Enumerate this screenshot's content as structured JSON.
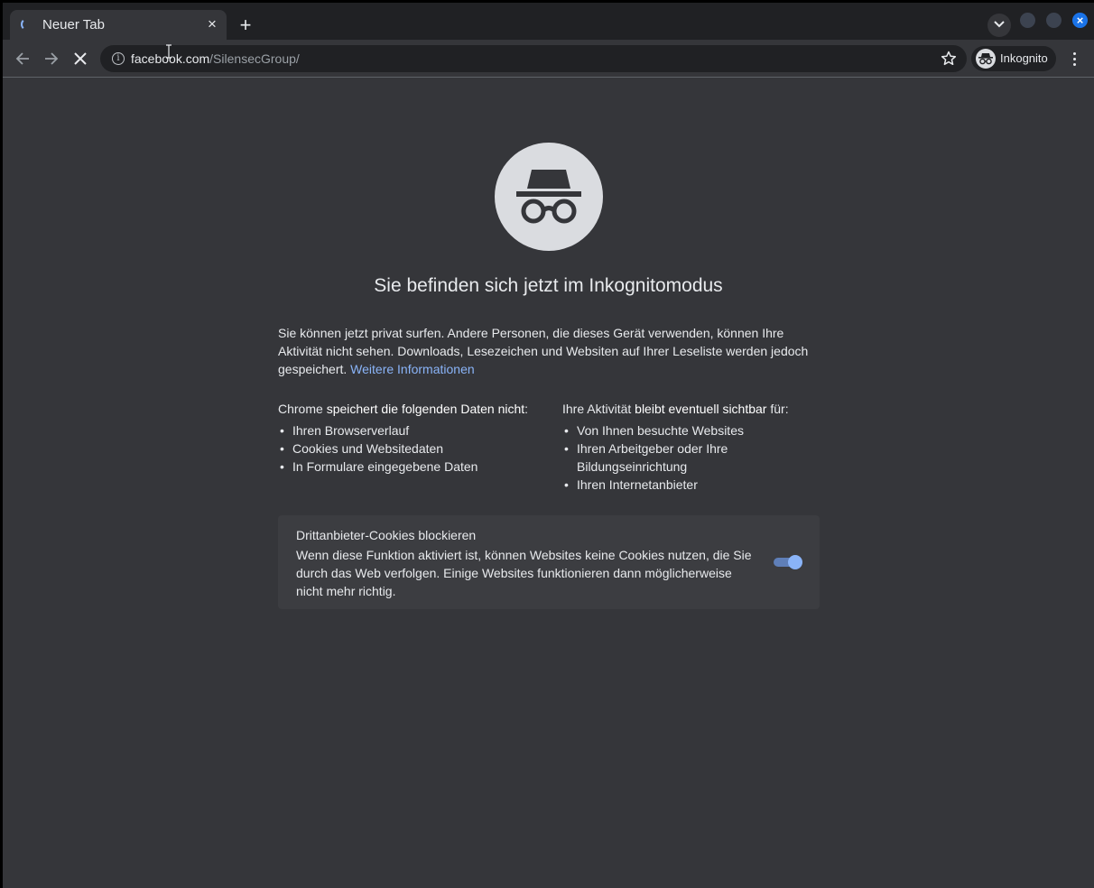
{
  "tab": {
    "title": "Neuer Tab",
    "close": "×"
  },
  "new_tab": "+",
  "window_controls": {
    "close": "×"
  },
  "toolbar": {
    "url_host": "facebook.com",
    "url_path": "/SilensecGroup/",
    "profile_label": "Inkognito"
  },
  "page": {
    "heading": "Sie befinden sich jetzt im Inkognitomodus",
    "intro": "Sie können jetzt privat surfen. Andere Personen, die dieses Gerät verwenden, können Ihre Aktivität nicht sehen. Downloads, Lesezeichen und Websiten auf Ihrer Leseliste werden jedoch gespeichert.",
    "learn_more": "Weitere Informationen",
    "left_col": {
      "title_prefix": "Chrome ",
      "title_bold": "speichert die folgenden Daten nicht",
      "title_suffix": ":",
      "items": [
        "Ihren Browserverlauf",
        "Cookies und Websitedaten",
        "In Formulare eingegebene Daten"
      ]
    },
    "right_col": {
      "title_prefix": "Ihre Aktivität ",
      "title_bold": "bleibt eventuell sichtbar",
      "title_suffix": " für:",
      "items": [
        "Von Ihnen besuchte Websites",
        "Ihren Arbeitgeber oder Ihre Bildungseinrichtung",
        "Ihren Internetanbieter"
      ]
    },
    "cookie_card": {
      "title": "Drittanbieter-Cookies blockieren",
      "description": "Wenn diese Funktion aktiviert ist, können Websites keine Cookies nutzen, die Sie durch das Web verfolgen. Einige Websites funktionieren dann möglicherweise nicht mehr richtig.",
      "toggle_on": true
    }
  },
  "colors": {
    "background": "#35363a",
    "tabstrip": "#202124",
    "link": "#8ab4f8",
    "accent": "#1a73e8"
  }
}
